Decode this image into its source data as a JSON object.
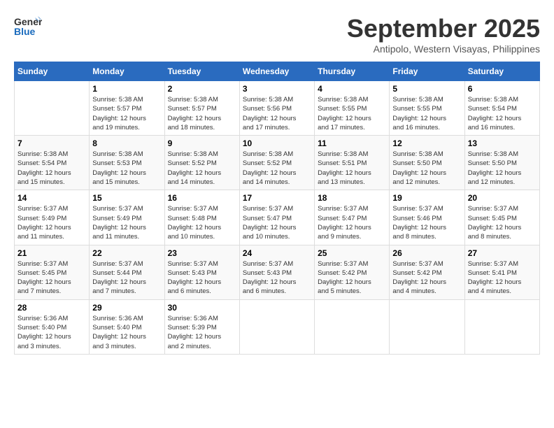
{
  "header": {
    "logo_general": "General",
    "logo_blue": "Blue",
    "month": "September 2025",
    "location": "Antipolo, Western Visayas, Philippines"
  },
  "days_of_week": [
    "Sunday",
    "Monday",
    "Tuesday",
    "Wednesday",
    "Thursday",
    "Friday",
    "Saturday"
  ],
  "weeks": [
    [
      {
        "day": "",
        "info": ""
      },
      {
        "day": "1",
        "info": "Sunrise: 5:38 AM\nSunset: 5:57 PM\nDaylight: 12 hours\nand 19 minutes."
      },
      {
        "day": "2",
        "info": "Sunrise: 5:38 AM\nSunset: 5:57 PM\nDaylight: 12 hours\nand 18 minutes."
      },
      {
        "day": "3",
        "info": "Sunrise: 5:38 AM\nSunset: 5:56 PM\nDaylight: 12 hours\nand 17 minutes."
      },
      {
        "day": "4",
        "info": "Sunrise: 5:38 AM\nSunset: 5:55 PM\nDaylight: 12 hours\nand 17 minutes."
      },
      {
        "day": "5",
        "info": "Sunrise: 5:38 AM\nSunset: 5:55 PM\nDaylight: 12 hours\nand 16 minutes."
      },
      {
        "day": "6",
        "info": "Sunrise: 5:38 AM\nSunset: 5:54 PM\nDaylight: 12 hours\nand 16 minutes."
      }
    ],
    [
      {
        "day": "7",
        "info": "Sunrise: 5:38 AM\nSunset: 5:54 PM\nDaylight: 12 hours\nand 15 minutes."
      },
      {
        "day": "8",
        "info": "Sunrise: 5:38 AM\nSunset: 5:53 PM\nDaylight: 12 hours\nand 15 minutes."
      },
      {
        "day": "9",
        "info": "Sunrise: 5:38 AM\nSunset: 5:52 PM\nDaylight: 12 hours\nand 14 minutes."
      },
      {
        "day": "10",
        "info": "Sunrise: 5:38 AM\nSunset: 5:52 PM\nDaylight: 12 hours\nand 14 minutes."
      },
      {
        "day": "11",
        "info": "Sunrise: 5:38 AM\nSunset: 5:51 PM\nDaylight: 12 hours\nand 13 minutes."
      },
      {
        "day": "12",
        "info": "Sunrise: 5:38 AM\nSunset: 5:50 PM\nDaylight: 12 hours\nand 12 minutes."
      },
      {
        "day": "13",
        "info": "Sunrise: 5:38 AM\nSunset: 5:50 PM\nDaylight: 12 hours\nand 12 minutes."
      }
    ],
    [
      {
        "day": "14",
        "info": "Sunrise: 5:37 AM\nSunset: 5:49 PM\nDaylight: 12 hours\nand 11 minutes."
      },
      {
        "day": "15",
        "info": "Sunrise: 5:37 AM\nSunset: 5:49 PM\nDaylight: 12 hours\nand 11 minutes."
      },
      {
        "day": "16",
        "info": "Sunrise: 5:37 AM\nSunset: 5:48 PM\nDaylight: 12 hours\nand 10 minutes."
      },
      {
        "day": "17",
        "info": "Sunrise: 5:37 AM\nSunset: 5:47 PM\nDaylight: 12 hours\nand 10 minutes."
      },
      {
        "day": "18",
        "info": "Sunrise: 5:37 AM\nSunset: 5:47 PM\nDaylight: 12 hours\nand 9 minutes."
      },
      {
        "day": "19",
        "info": "Sunrise: 5:37 AM\nSunset: 5:46 PM\nDaylight: 12 hours\nand 8 minutes."
      },
      {
        "day": "20",
        "info": "Sunrise: 5:37 AM\nSunset: 5:45 PM\nDaylight: 12 hours\nand 8 minutes."
      }
    ],
    [
      {
        "day": "21",
        "info": "Sunrise: 5:37 AM\nSunset: 5:45 PM\nDaylight: 12 hours\nand 7 minutes."
      },
      {
        "day": "22",
        "info": "Sunrise: 5:37 AM\nSunset: 5:44 PM\nDaylight: 12 hours\nand 7 minutes."
      },
      {
        "day": "23",
        "info": "Sunrise: 5:37 AM\nSunset: 5:43 PM\nDaylight: 12 hours\nand 6 minutes."
      },
      {
        "day": "24",
        "info": "Sunrise: 5:37 AM\nSunset: 5:43 PM\nDaylight: 12 hours\nand 6 minutes."
      },
      {
        "day": "25",
        "info": "Sunrise: 5:37 AM\nSunset: 5:42 PM\nDaylight: 12 hours\nand 5 minutes."
      },
      {
        "day": "26",
        "info": "Sunrise: 5:37 AM\nSunset: 5:42 PM\nDaylight: 12 hours\nand 4 minutes."
      },
      {
        "day": "27",
        "info": "Sunrise: 5:37 AM\nSunset: 5:41 PM\nDaylight: 12 hours\nand 4 minutes."
      }
    ],
    [
      {
        "day": "28",
        "info": "Sunrise: 5:36 AM\nSunset: 5:40 PM\nDaylight: 12 hours\nand 3 minutes."
      },
      {
        "day": "29",
        "info": "Sunrise: 5:36 AM\nSunset: 5:40 PM\nDaylight: 12 hours\nand 3 minutes."
      },
      {
        "day": "30",
        "info": "Sunrise: 5:36 AM\nSunset: 5:39 PM\nDaylight: 12 hours\nand 2 minutes."
      },
      {
        "day": "",
        "info": ""
      },
      {
        "day": "",
        "info": ""
      },
      {
        "day": "",
        "info": ""
      },
      {
        "day": "",
        "info": ""
      }
    ]
  ]
}
